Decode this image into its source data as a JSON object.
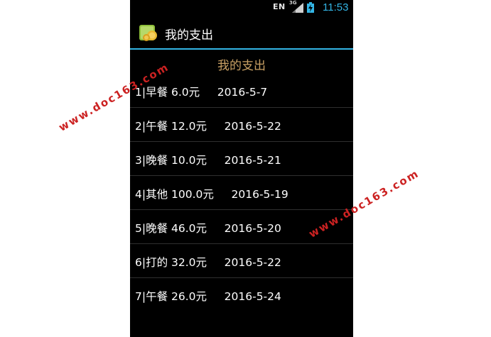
{
  "status_bar": {
    "input_method": "EN",
    "network": "3G",
    "time": "11:53"
  },
  "action_bar": {
    "title": "我的支出",
    "icon": "wallet-app-icon"
  },
  "content": {
    "heading": "我的支出",
    "items": [
      {
        "text": "1|早餐 6.0元     2016-5-7"
      },
      {
        "text": "2|午餐 12.0元     2016-5-22"
      },
      {
        "text": "3|晚餐 10.0元     2016-5-21"
      },
      {
        "text": "4|其他 100.0元     2016-5-19"
      },
      {
        "text": "5|晚餐 46.0元     2016-5-20"
      },
      {
        "text": "6|打的 32.0元     2016-5-22"
      },
      {
        "text": "7|午餐 26.0元     2016-5-24"
      }
    ]
  },
  "watermarks": [
    "www.doc163.com",
    "www.doc163.com"
  ],
  "colors": {
    "accent": "#33b5e5",
    "heading": "#c8a064",
    "watermark": "#cc2222"
  }
}
